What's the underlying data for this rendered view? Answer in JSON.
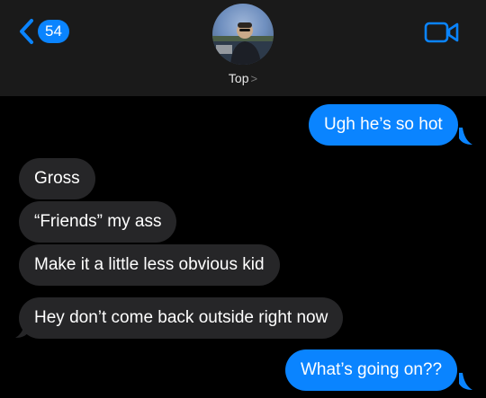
{
  "header": {
    "back_count": "54",
    "contact_name": "Top",
    "contact_chevron": ">",
    "back_icon": "chevron-left-icon",
    "video_icon": "video-camera-icon"
  },
  "colors": {
    "accent": "#0a84ff",
    "incoming_bubble": "#262628",
    "header_bg": "#1a1a1a",
    "background": "#000000"
  },
  "messages": [
    {
      "direction": "outgoing",
      "text": "Ugh he’s so hot"
    },
    {
      "direction": "incoming",
      "text": "Gross"
    },
    {
      "direction": "incoming",
      "text": "“Friends” my ass"
    },
    {
      "direction": "incoming",
      "text": "Make it a little less obvious kid"
    },
    {
      "direction": "incoming",
      "text": "Hey don’t come back outside right now"
    },
    {
      "direction": "outgoing",
      "text": "What’s going on??"
    }
  ]
}
